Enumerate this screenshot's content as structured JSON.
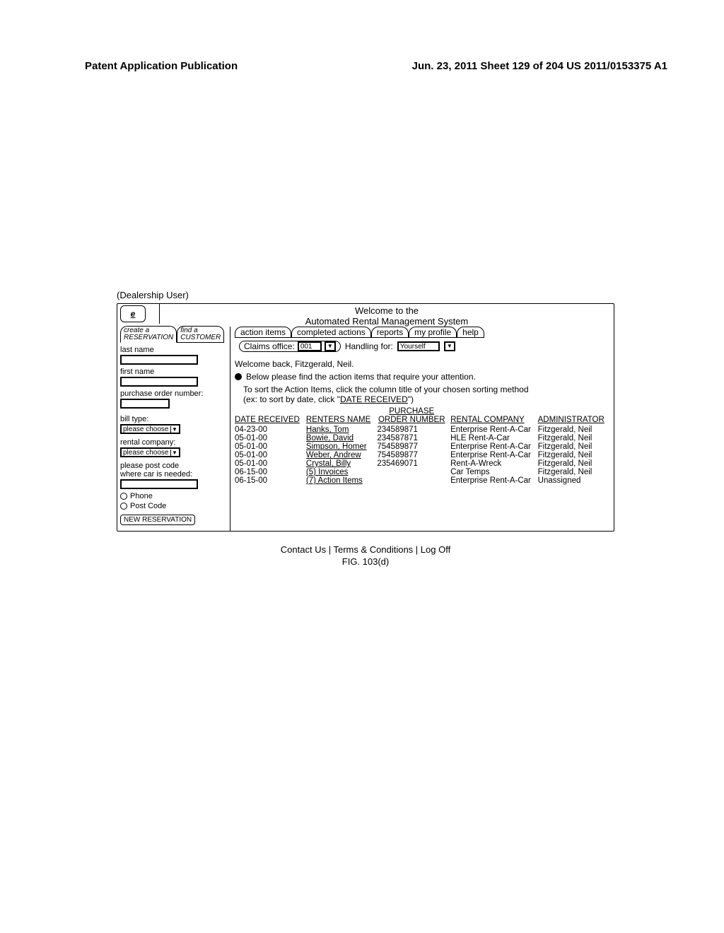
{
  "header": {
    "left": "Patent Application Publication",
    "right": "Jun. 23, 2011 Sheet 129 of 204   US 2011/0153375 A1"
  },
  "user_label": "(Dealership User)",
  "logo": "e",
  "welcome": {
    "line1": "Welcome to the",
    "line2": "Automated Rental Management System"
  },
  "side_tabs": {
    "create": "create a\nRESERVATION",
    "find": "find a\nCUSTOMER"
  },
  "sidebar": {
    "last_name_label": "last name",
    "last_name_value": "",
    "first_name_label": "first name",
    "first_name_value": "",
    "po_label": "purchase order number:",
    "po_value": "",
    "bill_type_label": "bill type:",
    "bill_type_value": "please choose",
    "rental_company_label": "rental company:",
    "rental_company_value": "please choose",
    "post_code_label": "please post code\nwhere car is needed:",
    "post_code_value": "",
    "radio_phone": "Phone",
    "radio_post_code": "Post Code",
    "new_reservation_btn": "NEW RESERVATION"
  },
  "top_tabs": {
    "action_items": "action items",
    "completed_actions": "completed actions",
    "reports": "reports",
    "my_profile": "my profile",
    "help": "help"
  },
  "filters": {
    "claims_office_label": "Claims office:",
    "claims_office_value": "001",
    "handling_for_label": "Handling for:",
    "handling_for_value": "Yourself"
  },
  "welcome_back": "Welcome back, Fitzgerald, Neil.",
  "info_line": "Below please find the action items that require your attention.",
  "sort_hint": {
    "line1": "To sort the Action Items, click the column title of your chosen sorting method",
    "line2_prefix": "(ex: to sort by date, click \"",
    "line2_link": "DATE RECEIVED",
    "line2_suffix": "\")"
  },
  "table": {
    "headers": {
      "date_received": "DATE RECEIVED",
      "renters_name": "RENTERS NAME",
      "purchase_order": "PURCHASE\nORDER NUMBER",
      "rental_company": "RENTAL COMPANY",
      "administrator": "ADMINISTRATOR"
    },
    "rows": [
      {
        "date": "04-23-00",
        "name": "Hanks, Tom",
        "po": "234589871",
        "company": "Enterprise Rent-A-Car",
        "admin": "Fitzgerald, Neil",
        "name_ul": true
      },
      {
        "date": "05-01-00",
        "name": "Bowie, David",
        "po": "234587871",
        "company": "HLE Rent-A-Car",
        "admin": "Fitzgerald, Neil",
        "name_ul": true
      },
      {
        "date": "05-01-00",
        "name": "Simpson, Homer",
        "po": "754589877",
        "company": "Enterprise Rent-A-Car",
        "admin": "Fitzgerald, Neil",
        "name_ul": true
      },
      {
        "date": "05-01-00",
        "name": "Weber, Andrew",
        "po": "754589877",
        "company": "Enterprise Rent-A-Car",
        "admin": "Fitzgerald, Neil",
        "name_ul": true
      },
      {
        "date": "05-01-00",
        "name": "Crystal, Billy",
        "po": "235469071",
        "company": "Rent-A-Wreck",
        "admin": "Fitzgerald, Neil",
        "name_ul": true
      },
      {
        "date": "06-15-00",
        "name": "(5) Invoices",
        "po": "",
        "company": "Car Temps",
        "admin": "Fitzgerald, Neil",
        "name_ul": true
      },
      {
        "date": "06-15-00",
        "name": "(7) Action Items",
        "po": "",
        "company": "Enterprise Rent-A-Car",
        "admin": "Unassigned",
        "name_ul": true
      }
    ]
  },
  "footer": {
    "links": "Contact Us | Terms & Conditions | Log Off",
    "fig": "FIG. 103(d)"
  }
}
